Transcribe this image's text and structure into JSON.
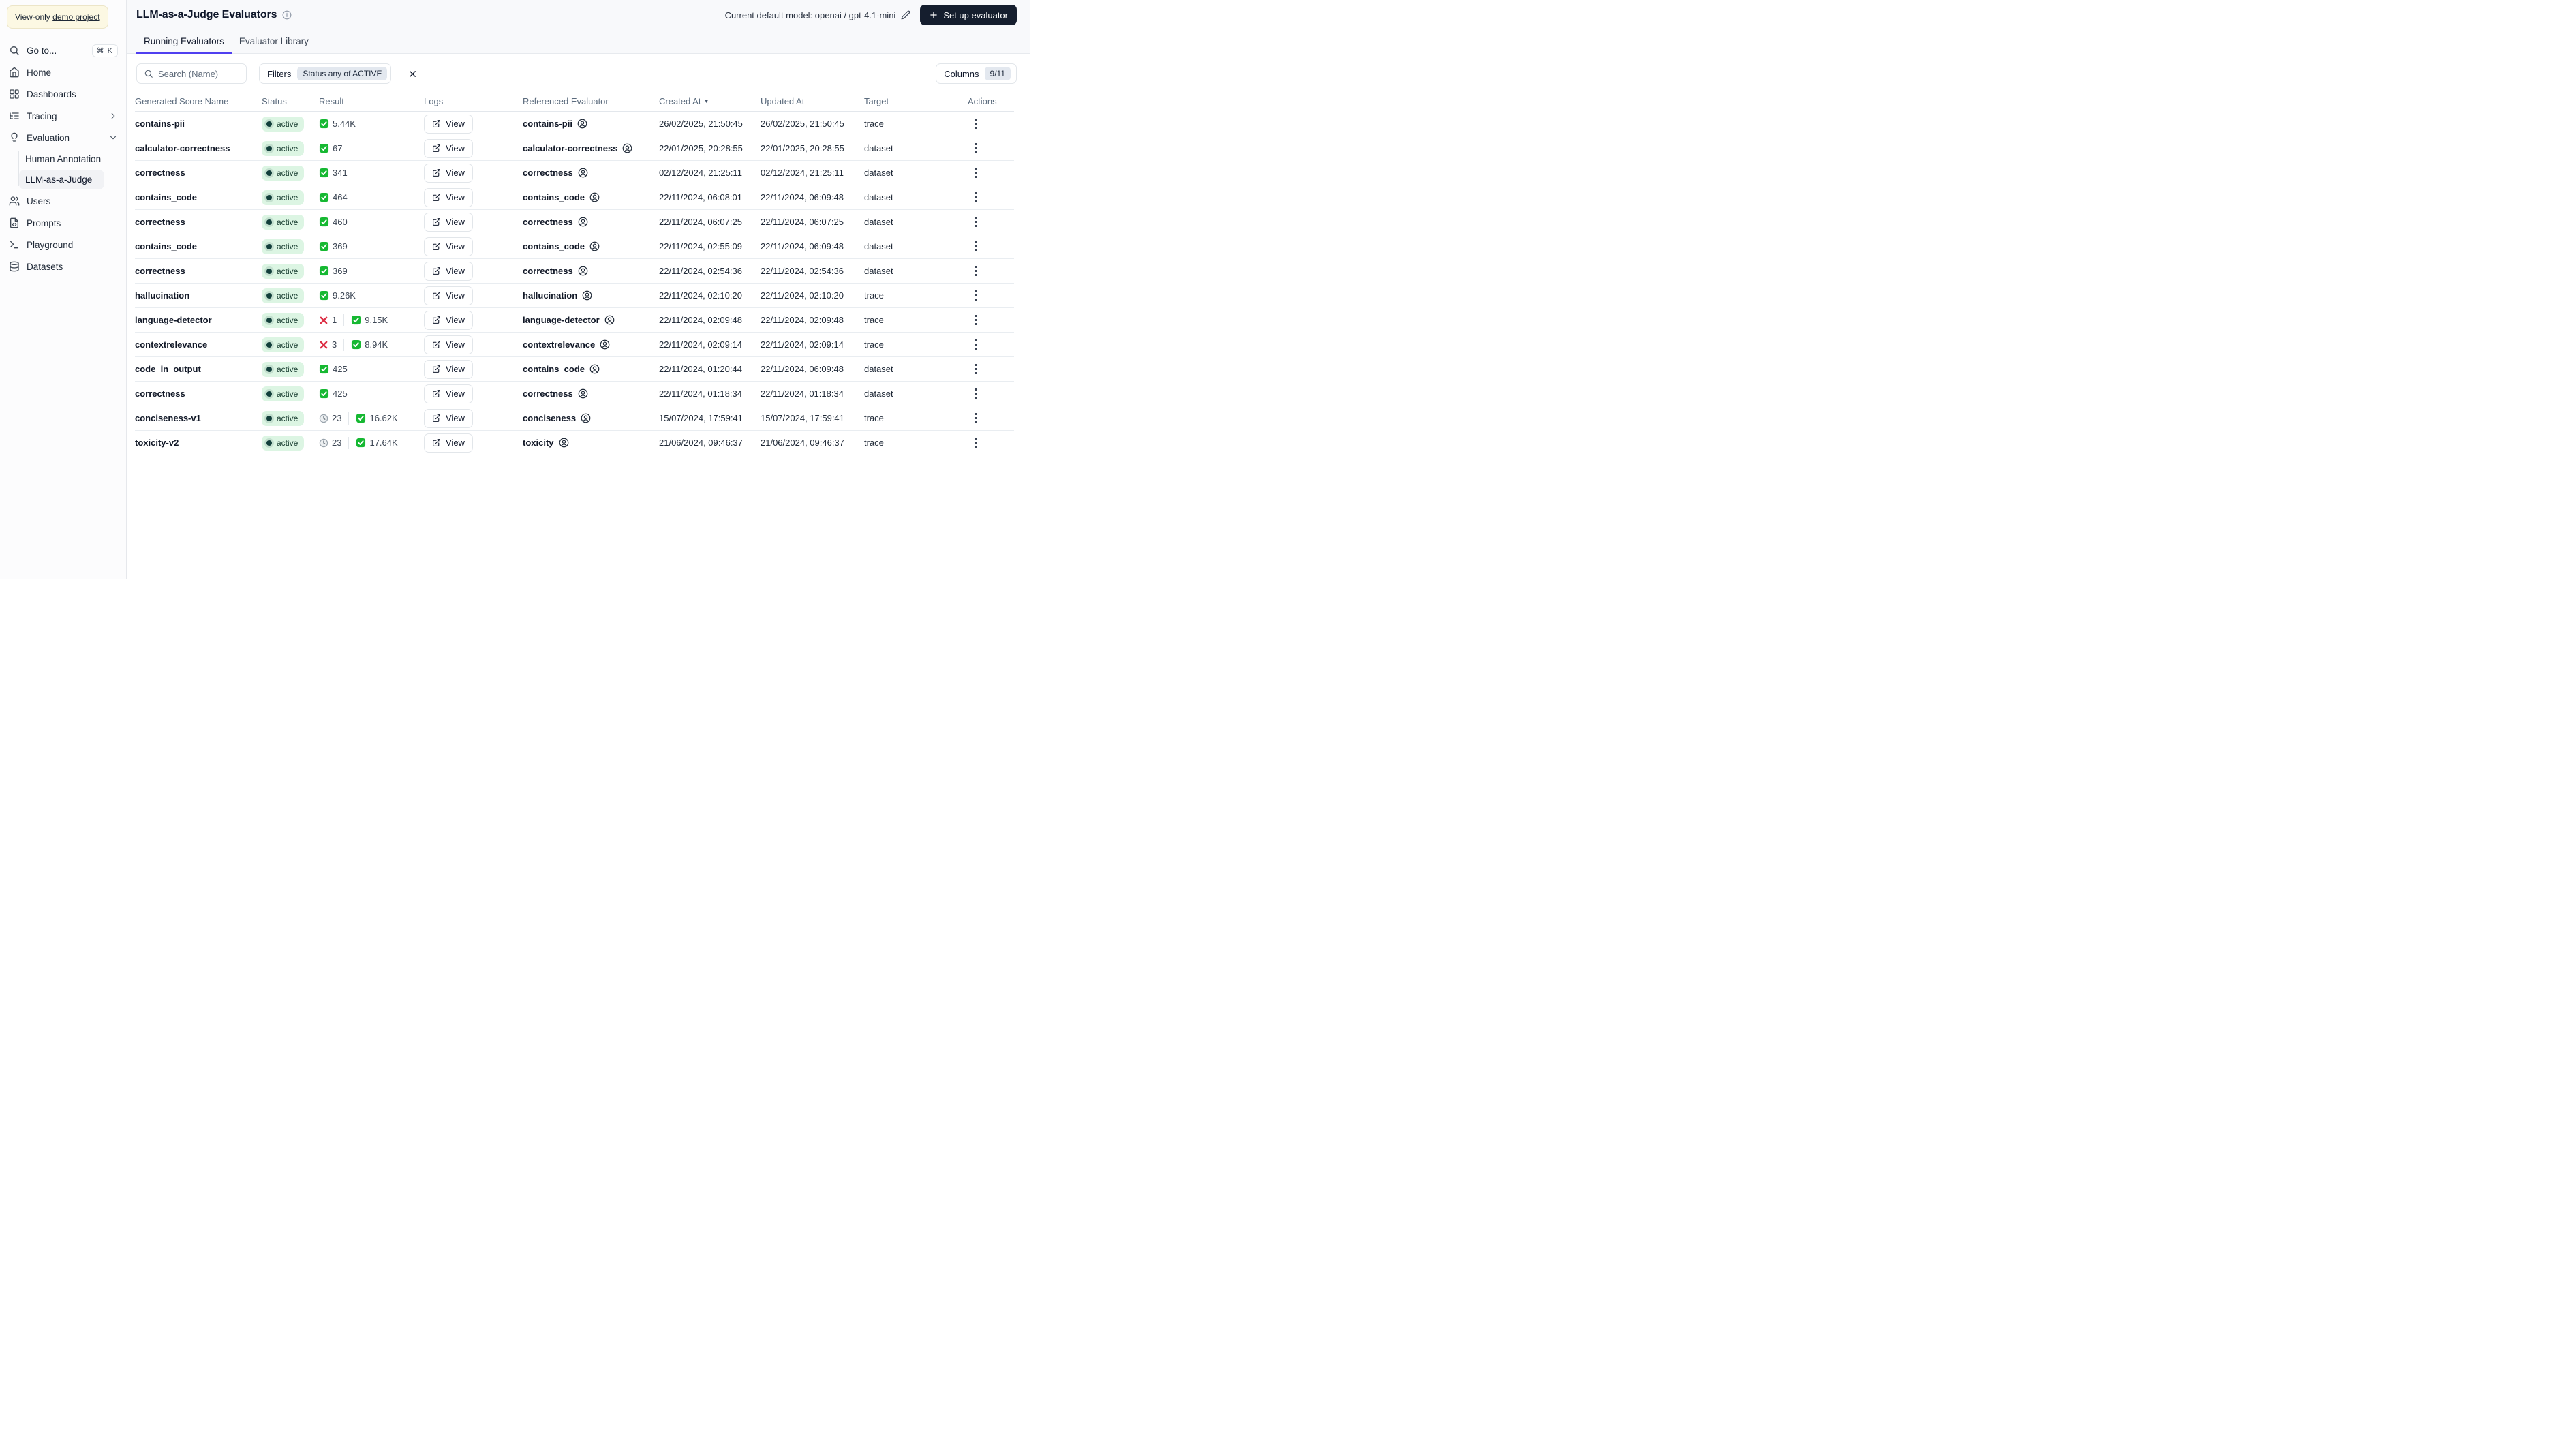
{
  "sidebar": {
    "banner": {
      "prefix": "View-only",
      "link": "demo project"
    },
    "goto": {
      "label": "Go to...",
      "shortcut": "⌘ K"
    },
    "items": [
      {
        "label": "Home",
        "icon": "home-icon"
      },
      {
        "label": "Dashboards",
        "icon": "dashboards-icon"
      },
      {
        "label": "Tracing",
        "icon": "tracing-icon"
      },
      {
        "label": "Evaluation",
        "icon": "evaluation-icon"
      }
    ],
    "evaluation_children": [
      {
        "label": "Human Annotation",
        "active": false
      },
      {
        "label": "LLM-as-a-Judge",
        "active": true
      }
    ],
    "items_bottom": [
      {
        "label": "Users",
        "icon": "users-icon"
      },
      {
        "label": "Prompts",
        "icon": "prompts-icon"
      },
      {
        "label": "Playground",
        "icon": "playground-icon"
      },
      {
        "label": "Datasets",
        "icon": "datasets-icon"
      }
    ]
  },
  "header": {
    "title": "LLM-as-a-Judge Evaluators",
    "default_model_label": "Current default model: openai / gpt-4.1-mini",
    "setup_button_label": "Set up evaluator",
    "tabs": [
      {
        "label": "Running Evaluators",
        "active": true
      },
      {
        "label": "Evaluator Library",
        "active": false
      }
    ]
  },
  "toolbar": {
    "search_placeholder": "Search (Name)",
    "filters_label": "Filters",
    "filter_chip": "Status any of ACTIVE",
    "columns_label": "Columns",
    "columns_count": "9/11"
  },
  "table": {
    "headers": [
      "Generated Score Name",
      "Status",
      "Result",
      "Logs",
      "Referenced Evaluator",
      "Created At",
      "Updated At",
      "Target",
      "Actions"
    ],
    "sort_arrow": "▼",
    "sorted_column": "Created At",
    "view_label": "View",
    "rows": [
      {
        "name": "contains-pii",
        "status": "active",
        "result": [
          {
            "icon": "check",
            "value": "5.44K"
          }
        ],
        "referenced": "contains-pii",
        "created": "26/02/2025, 21:50:45",
        "updated": "26/02/2025, 21:50:45",
        "target": "trace"
      },
      {
        "name": "calculator-correctness",
        "status": "active",
        "result": [
          {
            "icon": "check",
            "value": "67"
          }
        ],
        "referenced": "calculator-correctness",
        "created": "22/01/2025, 20:28:55",
        "updated": "22/01/2025, 20:28:55",
        "target": "dataset"
      },
      {
        "name": "correctness",
        "status": "active",
        "result": [
          {
            "icon": "check",
            "value": "341"
          }
        ],
        "referenced": "correctness",
        "created": "02/12/2024, 21:25:11",
        "updated": "02/12/2024, 21:25:11",
        "target": "dataset"
      },
      {
        "name": "contains_code",
        "status": "active",
        "result": [
          {
            "icon": "check",
            "value": "464"
          }
        ],
        "referenced": "contains_code",
        "created": "22/11/2024, 06:08:01",
        "updated": "22/11/2024, 06:09:48",
        "target": "dataset"
      },
      {
        "name": "correctness",
        "status": "active",
        "result": [
          {
            "icon": "check",
            "value": "460"
          }
        ],
        "referenced": "correctness",
        "created": "22/11/2024, 06:07:25",
        "updated": "22/11/2024, 06:07:25",
        "target": "dataset"
      },
      {
        "name": "contains_code",
        "status": "active",
        "result": [
          {
            "icon": "check",
            "value": "369"
          }
        ],
        "referenced": "contains_code",
        "created": "22/11/2024, 02:55:09",
        "updated": "22/11/2024, 06:09:48",
        "target": "dataset"
      },
      {
        "name": "correctness",
        "status": "active",
        "result": [
          {
            "icon": "check",
            "value": "369"
          }
        ],
        "referenced": "correctness",
        "created": "22/11/2024, 02:54:36",
        "updated": "22/11/2024, 02:54:36",
        "target": "dataset"
      },
      {
        "name": "hallucination",
        "status": "active",
        "result": [
          {
            "icon": "check",
            "value": "9.26K"
          }
        ],
        "referenced": "hallucination",
        "created": "22/11/2024, 02:10:20",
        "updated": "22/11/2024, 02:10:20",
        "target": "trace"
      },
      {
        "name": "language-detector",
        "status": "active",
        "result": [
          {
            "icon": "x",
            "value": "1"
          },
          {
            "icon": "check",
            "value": "9.15K"
          }
        ],
        "referenced": "language-detector",
        "created": "22/11/2024, 02:09:48",
        "updated": "22/11/2024, 02:09:48",
        "target": "trace"
      },
      {
        "name": "contextrelevance",
        "status": "active",
        "result": [
          {
            "icon": "x",
            "value": "3"
          },
          {
            "icon": "check",
            "value": "8.94K"
          }
        ],
        "referenced": "contextrelevance",
        "created": "22/11/2024, 02:09:14",
        "updated": "22/11/2024, 02:09:14",
        "target": "trace"
      },
      {
        "name": "code_in_output",
        "status": "active",
        "result": [
          {
            "icon": "check",
            "value": "425"
          }
        ],
        "referenced": "contains_code",
        "created": "22/11/2024, 01:20:44",
        "updated": "22/11/2024, 06:09:48",
        "target": "dataset"
      },
      {
        "name": "correctness",
        "status": "active",
        "result": [
          {
            "icon": "check",
            "value": "425"
          }
        ],
        "referenced": "correctness",
        "created": "22/11/2024, 01:18:34",
        "updated": "22/11/2024, 01:18:34",
        "target": "dataset"
      },
      {
        "name": "conciseness-v1",
        "status": "active",
        "result": [
          {
            "icon": "clock",
            "value": "23"
          },
          {
            "icon": "check",
            "value": "16.62K"
          }
        ],
        "referenced": "conciseness",
        "created": "15/07/2024, 17:59:41",
        "updated": "15/07/2024, 17:59:41",
        "target": "trace"
      },
      {
        "name": "toxicity-v2",
        "status": "active",
        "result": [
          {
            "icon": "clock",
            "value": "23"
          },
          {
            "icon": "check",
            "value": "17.64K"
          }
        ],
        "referenced": "toxicity",
        "created": "21/06/2024, 09:46:37",
        "updated": "21/06/2024, 09:46:37",
        "target": "trace"
      }
    ]
  },
  "colors": {
    "accent_tab_underline": "#4f3ff0",
    "status_badge_bg": "#dcf5e3",
    "status_badge_text": "#173c30",
    "check_green": "#16b832",
    "cross_red": "#dd2e44",
    "setup_button_bg": "#151e2e",
    "banner_bg": "#fcf8e3"
  }
}
